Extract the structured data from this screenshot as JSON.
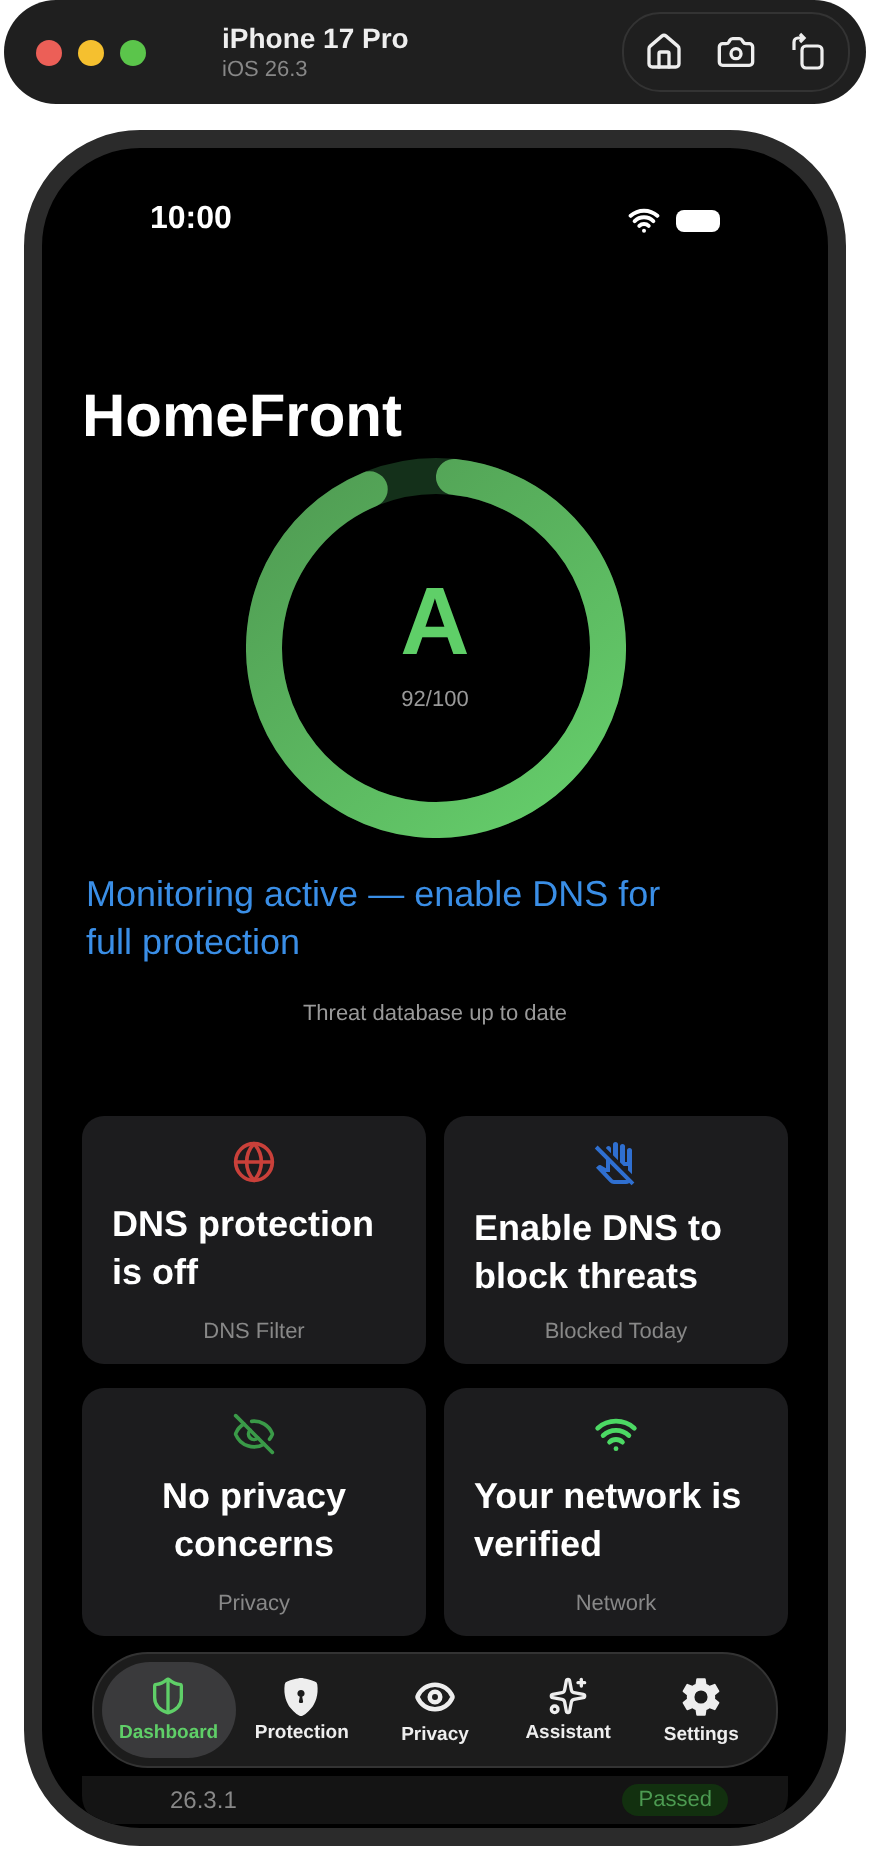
{
  "simulator": {
    "device": "iPhone 17 Pro",
    "os": "iOS 26.3"
  },
  "status_bar": {
    "time": "10:00"
  },
  "title": "HomeFront",
  "score": {
    "grade": "A",
    "reading": "92/100",
    "level": 0.92
  },
  "status_message": "Monitoring active — enable DNS for full protection",
  "database_note": "Threat database up to date",
  "cards": [
    {
      "kind": "dns",
      "title": "DNS protection is off",
      "caption": "DNS Filter",
      "color": "#c9403a"
    },
    {
      "kind": "blocked",
      "title": "Enable DNS to block threats",
      "caption": "Blocked Today",
      "color": "#2f6fd0"
    },
    {
      "kind": "privacy",
      "title": "No privacy concerns",
      "caption": "Privacy",
      "color": "#3a9a48"
    },
    {
      "kind": "network",
      "title": "Your network is verified",
      "caption": "Network",
      "color": "#4cd964"
    }
  ],
  "check_row": {
    "detail": "26.3.1",
    "badge": "Passed"
  },
  "tabs": [
    {
      "kind": "dashboard",
      "label": "Dashboard",
      "selected": true
    },
    {
      "kind": "protection",
      "label": "Protection",
      "selected": false
    },
    {
      "kind": "privacy",
      "label": "Privacy",
      "selected": false
    },
    {
      "kind": "assistant",
      "label": "Assistant",
      "selected": false
    },
    {
      "kind": "settings",
      "label": "Settings",
      "selected": false
    }
  ]
}
